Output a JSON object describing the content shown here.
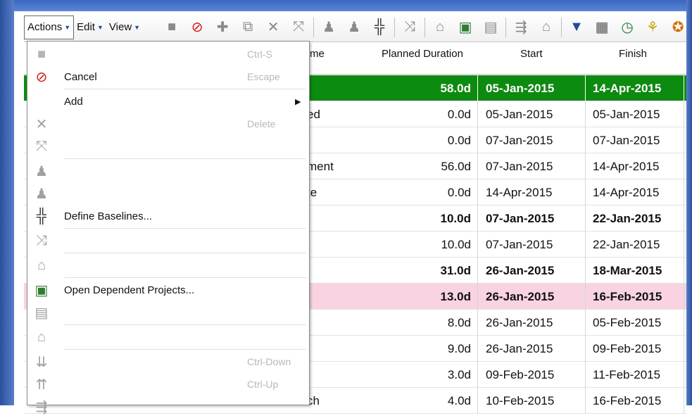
{
  "menubar": {
    "actions": "Actions",
    "edit": "Edit",
    "view": "View"
  },
  "toolbar_icons": [
    "save-icon",
    "cancel-icon",
    "add-icon",
    "add-multiple-icon",
    "delete-icon",
    "unlink-icon",
    "user-icon",
    "user-disabled-icon",
    "baseline-icon",
    "link-icon",
    "unlock-icon",
    "open-project-icon",
    "project-icon",
    "flow-icon",
    "building-icon",
    "import-icon",
    "report-icon",
    "clock-icon",
    "network-icon",
    "money-icon"
  ],
  "columns": {
    "name": "me",
    "planned": "Planned Duration",
    "start": "Start",
    "finish": "Finish"
  },
  "rows": [
    {
      "name": "",
      "dur": "58.0d",
      "start": "05-Jan-2015",
      "finish": "14-Apr-2015",
      "style": "green bold"
    },
    {
      "name": "ed",
      "dur": "0.0d",
      "start": "05-Jan-2015",
      "finish": "05-Jan-2015",
      "style": ""
    },
    {
      "name": "",
      "dur": "0.0d",
      "start": "07-Jan-2015",
      "finish": "07-Jan-2015",
      "style": ""
    },
    {
      "name": "ment",
      "dur": "56.0d",
      "start": "07-Jan-2015",
      "finish": "14-Apr-2015",
      "style": ""
    },
    {
      "name": "te",
      "dur": "0.0d",
      "start": "14-Apr-2015",
      "finish": "14-Apr-2015",
      "style": ""
    },
    {
      "name": "",
      "dur": "10.0d",
      "start": "07-Jan-2015",
      "finish": "22-Jan-2015",
      "style": "bold"
    },
    {
      "name": "",
      "dur": "10.0d",
      "start": "07-Jan-2015",
      "finish": "22-Jan-2015",
      "style": ""
    },
    {
      "name": "",
      "dur": "31.0d",
      "start": "26-Jan-2015",
      "finish": "18-Mar-2015",
      "style": "bold"
    },
    {
      "name": "",
      "dur": "13.0d",
      "start": "26-Jan-2015",
      "finish": "16-Feb-2015",
      "style": "pink bold"
    },
    {
      "name": "",
      "dur": "8.0d",
      "start": "26-Jan-2015",
      "finish": "05-Feb-2015",
      "style": ""
    },
    {
      "name": "",
      "dur": "9.0d",
      "start": "26-Jan-2015",
      "finish": "09-Feb-2015",
      "style": ""
    },
    {
      "name": "",
      "dur": "3.0d",
      "start": "09-Feb-2015",
      "finish": "11-Feb-2015",
      "style": ""
    },
    {
      "name": "ch",
      "dur": "4.0d",
      "start": "10-Feb-2015",
      "finish": "16-Feb-2015",
      "style": ""
    }
  ],
  "dropdown": {
    "items": [
      {
        "icon": "save-icon",
        "label": "",
        "shortcut": "Ctrl-S",
        "enabled": false
      },
      {
        "icon": "cancel-icon",
        "label": "Cancel",
        "shortcut": "Escape",
        "enabled": true
      },
      {
        "icon": "",
        "label": "Add",
        "shortcut": "",
        "enabled": true,
        "submenu": true
      },
      {
        "icon": "delete-icon",
        "label": "",
        "shortcut": "Delete",
        "enabled": false
      },
      {
        "icon": "unlink-icon",
        "label": "",
        "shortcut": "",
        "enabled": false
      },
      {
        "icon": "user-icon",
        "label": "",
        "shortcut": "",
        "enabled": false
      },
      {
        "icon": "user-disabled-icon",
        "label": "",
        "shortcut": "",
        "enabled": false
      },
      {
        "icon": "baseline-icon",
        "label": "Define Baselines...",
        "shortcut": "",
        "enabled": true
      },
      {
        "icon": "link-icon",
        "label": "",
        "shortcut": "",
        "enabled": false
      },
      {
        "icon": "unlock-icon",
        "label": "",
        "shortcut": "",
        "enabled": false
      },
      {
        "icon": "open-project-icon",
        "label": "Open Dependent Projects...",
        "shortcut": "",
        "enabled": true
      },
      {
        "icon": "project-icon",
        "label": "",
        "shortcut": "",
        "enabled": false
      },
      {
        "icon": "building-icon",
        "label": "",
        "shortcut": "",
        "enabled": false
      },
      {
        "icon": "move-down-icon",
        "label": "",
        "shortcut": "Ctrl-Down",
        "enabled": false
      },
      {
        "icon": "move-up-icon",
        "label": "",
        "shortcut": "Ctrl-Up",
        "enabled": false
      },
      {
        "icon": "flow-icon",
        "label": "",
        "shortcut": "",
        "enabled": false
      }
    ]
  }
}
